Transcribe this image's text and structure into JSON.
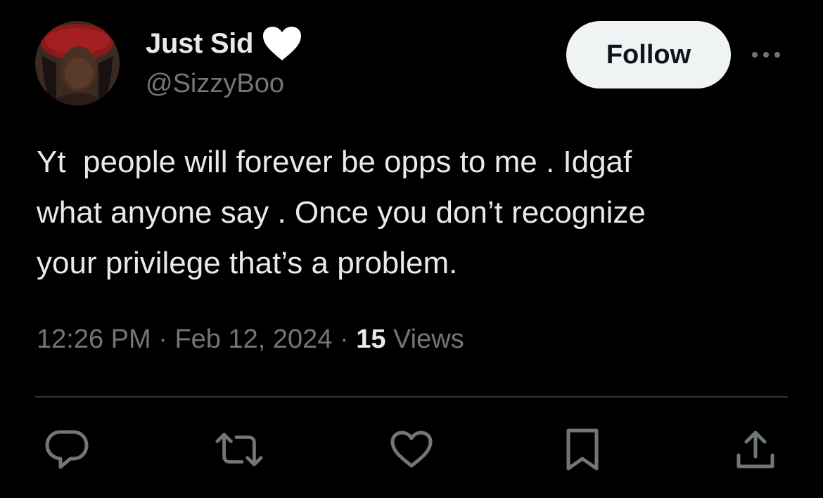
{
  "user": {
    "display_name": "Just Sid",
    "badge_icon": "heart-icon",
    "handle": "@SizzyBoo"
  },
  "follow_button": {
    "label": "Follow"
  },
  "more_menu": {
    "icon": "more-horizontal-icon"
  },
  "tweet": {
    "text": "Yt  people will forever be opps to me . Idgaf\nwhat anyone say . Once you don’t recognize\nyour privilege that’s a problem."
  },
  "meta": {
    "time": "12:26 PM",
    "separator": " · ",
    "date": "Feb 12, 2024",
    "views_count": "15",
    "views_label": " Views"
  },
  "actions": [
    {
      "name": "reply",
      "icon": "reply-icon"
    },
    {
      "name": "retweet",
      "icon": "retweet-icon"
    },
    {
      "name": "like",
      "icon": "like-icon"
    },
    {
      "name": "bookmark",
      "icon": "bookmark-icon"
    },
    {
      "name": "share",
      "icon": "share-icon"
    }
  ],
  "colors": {
    "background": "#000000",
    "primary_text": "#e7e9ea",
    "secondary_text": "#71767b",
    "follow_bg": "#eff3f4",
    "divider": "#2f3336"
  }
}
